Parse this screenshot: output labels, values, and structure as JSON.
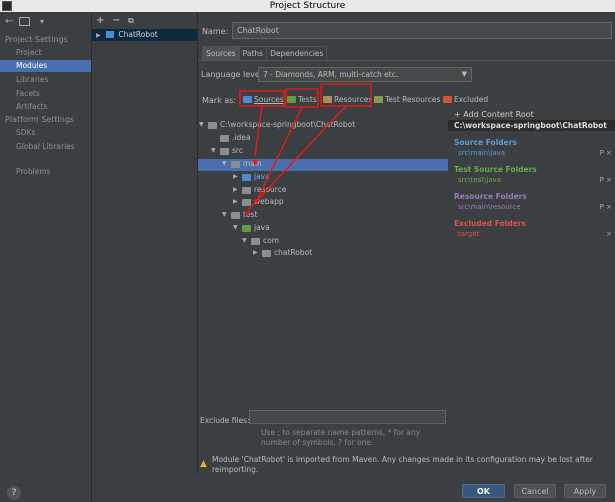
{
  "window": {
    "title": "Project Structure"
  },
  "left_nav": {
    "toolbar": {
      "back": "←",
      "forward_icon": "window-icon",
      "dropdown": "▾"
    },
    "project_settings_header": "Project Settings",
    "project_settings_items": [
      "Project",
      "Modules",
      "Libraries",
      "Facets",
      "Artifacts"
    ],
    "platform_settings_header": "Platform Settings",
    "platform_settings_items": [
      "SDKs",
      "Global Libraries"
    ],
    "problems_label": "Problems",
    "help": "?"
  },
  "modules": {
    "toolbar": {
      "add": "+",
      "remove": "−",
      "copy": "⧉"
    },
    "items": [
      {
        "label": "ChatRobot"
      }
    ]
  },
  "module": {
    "name_label": "Name:",
    "name_value": "ChatRobot",
    "tabs": [
      "Sources",
      "Paths",
      "Dependencies"
    ],
    "language_level_label": "Language level:",
    "language_level_value": "7 - Diamonds, ARM, multi-catch etc.",
    "mark_as_label": "Mark as:",
    "mark_buttons": [
      {
        "label": "Sources",
        "color": "#4a8ccf"
      },
      {
        "label": "Tests",
        "color": "#5e9c45"
      },
      {
        "label": "Resources",
        "color": "#b48a5a"
      },
      {
        "label": "Test Resources",
        "color": "#8a9a55"
      },
      {
        "label": "Excluded",
        "color": "#c85a2d"
      }
    ],
    "tree": [
      {
        "label": "C:\\workspace-springboot\\ChatRobot",
        "level": 0,
        "expanded": true
      },
      {
        "label": ".idea",
        "level": 1,
        "expanded": null
      },
      {
        "label": "src",
        "level": 1,
        "expanded": true
      },
      {
        "label": "main",
        "level": 2,
        "expanded": true
      },
      {
        "label": "java",
        "level": 3,
        "expanded": false,
        "selected": true,
        "color": "#4a8ccf"
      },
      {
        "label": "resource",
        "level": 3,
        "expanded": false
      },
      {
        "label": "webapp",
        "level": 3,
        "expanded": false
      },
      {
        "label": "test",
        "level": 2,
        "expanded": true
      },
      {
        "label": "java",
        "level": 3,
        "expanded": true,
        "color": "#5e9c45"
      },
      {
        "label": "com",
        "level": 4,
        "expanded": true
      },
      {
        "label": "chatRobot",
        "level": 5,
        "expanded": false
      }
    ],
    "exclude_files_label": "Exclude files:",
    "exclude_files_value": "",
    "exclude_hint": "Use ; to separate name patterns, * for any number of symbols, ? for one.",
    "warning": "Module 'ChatRobot' is imported from Maven. Any changes made in its configuration may be lost after reimporting."
  },
  "content_root": {
    "add_label": "+ Add Content Root",
    "root_path": "C:\\workspace-springboot\\ChatRobot",
    "sections": [
      {
        "title": "Source Folders",
        "color": "#5f9bd6",
        "path": "src\\main\\java",
        "path_color": "#5f9bd6"
      },
      {
        "title": "Test Source Folders",
        "color": "#6aab4f",
        "path": "src\\test\\java",
        "path_color": "#6aab4f"
      },
      {
        "title": "Resource Folders",
        "color": "#9b7bb5",
        "path": "src\\main\\resource",
        "path_color": "#9b7bb5"
      },
      {
        "title": "Excluded Folders",
        "color": "#d9534f",
        "path": "target",
        "path_color": "#d9534f"
      }
    ],
    "controls": {
      "properties": "P",
      "remove": "×"
    }
  },
  "buttons": {
    "ok": "OK",
    "cancel": "Cancel",
    "apply": "Apply"
  },
  "annotation_color": "#e01b1b"
}
